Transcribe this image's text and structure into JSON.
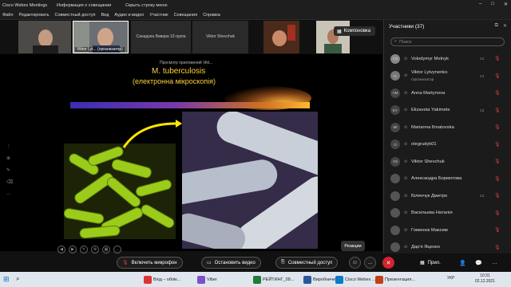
{
  "window": {
    "app_title": "Cisco Webex Meetings",
    "info_label": "Информация о совещании",
    "hide_bar_label": "Скрыть строку меню",
    "menu": [
      "Файл",
      "Редактировать",
      "Совместный доступ",
      "Вид",
      "Аудио и видео",
      "Участник",
      "Совещания",
      "Справка"
    ]
  },
  "thumbnails": [
    {
      "label": ""
    },
    {
      "label": "Viktor Lyt... (организатор)"
    },
    {
      "label": "Санадзна Вавара 10 група",
      "center": true
    },
    {
      "label": "Viktor Shevchuk",
      "center": true
    },
    {
      "label": ""
    },
    {
      "label": ""
    }
  ],
  "layout_button": "Компоновка",
  "slide": {
    "view_label": "Просмотр приложений Vikt...",
    "title": "M. tuberculosis",
    "subtitle": "(електронна мікроскопія)"
  },
  "reactions_label": "Реакции",
  "controls": {
    "mic": "Включить микрофон",
    "video": "Остановить видео",
    "share": "Совместный доступ",
    "apps": "Прил."
  },
  "participants_panel": {
    "title": "Участники (37)",
    "search_placeholder": "Поиск",
    "participants": [
      {
        "initials": "VM",
        "name": "Volodymyr Melnyk",
        "role": "",
        "cam": true,
        "avatar_color": "#888"
      },
      {
        "initials": "VL",
        "name": "Viktor Lytvynenko",
        "role": "Организатор",
        "cam": true,
        "avatar_color": "#777"
      },
      {
        "initials": "AM",
        "name": "Anna Martynova",
        "role": "",
        "cam": false,
        "avatar_color": "#444"
      },
      {
        "initials": "EY",
        "name": "Elizaveta Yakimets",
        "role": "",
        "cam": true,
        "avatar_color": "#444"
      },
      {
        "initials": "MI",
        "name": "Marianna Ihnatovska",
        "role": "",
        "cam": false,
        "avatar_color": "#444"
      },
      {
        "initials": "O",
        "name": "olegrudyk01",
        "role": "",
        "cam": false,
        "avatar_color": "#444"
      },
      {
        "initials": "VS",
        "name": "Viktor Shevchuk",
        "role": "",
        "cam": false,
        "avatar_color": "#444"
      },
      {
        "initials": "",
        "name": "Александра Бормотова",
        "role": "",
        "cam": false,
        "avatar_color": "#555"
      },
      {
        "initials": "",
        "name": "Білянчук Дмитро",
        "role": "",
        "cam": true,
        "avatar_color": "#555"
      },
      {
        "initials": "",
        "name": "Васильева Наталія",
        "role": "",
        "cam": false,
        "avatar_color": "#555"
      },
      {
        "initials": "",
        "name": "Гоменюк Максим",
        "role": "",
        "cam": false,
        "avatar_color": "#555"
      },
      {
        "initials": "",
        "name": "Дар'я Яценко",
        "role": "",
        "cam": false,
        "avatar_color": "#555"
      }
    ]
  },
  "taskbar": {
    "items": [
      {
        "label": "Вхід – облік...",
        "color": "#d33"
      },
      {
        "label": "Viber",
        "color": "#7b52c7"
      },
      {
        "label": "РЕЙТИНГ_09...",
        "color": "#1f7a3a"
      },
      {
        "label": "Виробниче ...",
        "color": "#2b579a"
      },
      {
        "label": "Cisco Webex ...",
        "color": "#0a7cc1"
      },
      {
        "label": "Презентация...",
        "color": "#c43e1c"
      }
    ],
    "lang": "УКР",
    "time": "10:31",
    "date": "02.12.2021"
  }
}
